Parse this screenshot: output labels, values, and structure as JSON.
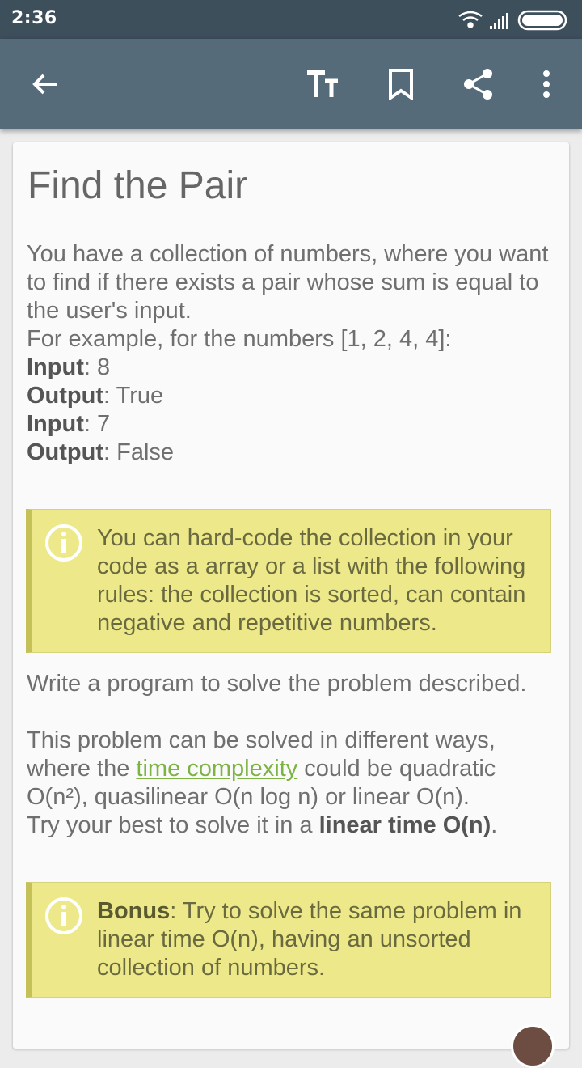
{
  "status": {
    "time": "2:36"
  },
  "toolbar": {
    "back_icon": "arrow-left-icon",
    "text_size_icon": "text-size-icon",
    "bookmark_icon": "bookmark-icon",
    "share_icon": "share-icon",
    "more_icon": "more-vert-icon"
  },
  "article": {
    "title": "Find the Pair",
    "intro": {
      "p1": "You have a collection of numbers, where you want to find if there exists a pair whose sum is equal to the user's input.",
      "p2": "For example, for the numbers [1, 2, 4, 4]:",
      "input_label": "Input",
      "input1": ": 8",
      "output_label": "Output",
      "output1": ": True",
      "input2": ": 7",
      "output2": ": False"
    },
    "note1": "You can hard-code the collection in your code as a array or a list with the following rules: the collection is sorted, can contain negative and repetitive numbers.",
    "task": "Write a program to solve the problem described.",
    "complexity": {
      "part1": "This problem can be solved in different ways, where the ",
      "link": "time complexity",
      "part2": " could be quadratic O(n²), quasilinear O(n log n) or linear O(n).",
      "part3": "Try your best to solve it in a ",
      "bold": "linear time O(n)",
      "part4": "."
    },
    "bonus": {
      "label": "Bonus",
      "text": ": Try to solve the same problem in linear time O(n), having an unsorted collection of numbers."
    }
  },
  "colors": {
    "status_bar": "#3e4f5c",
    "app_bar": "#556b7a",
    "note_bg": "#ede98a",
    "link": "#7cb342"
  }
}
